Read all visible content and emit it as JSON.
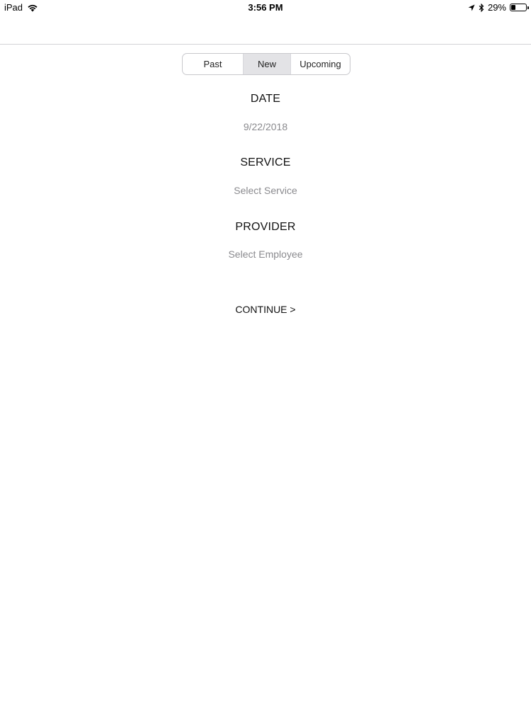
{
  "status_bar": {
    "device": "iPad",
    "time": "3:56 PM",
    "battery_percent": "29%",
    "battery_level": 0.29,
    "icons": [
      "wifi-icon",
      "location-icon",
      "bluetooth-icon",
      "battery-icon"
    ]
  },
  "tabs": {
    "items": [
      {
        "label": "Past",
        "selected": false
      },
      {
        "label": "New",
        "selected": true
      },
      {
        "label": "Upcoming",
        "selected": false
      }
    ],
    "selected_color": "#e3e3e6"
  },
  "form": {
    "date": {
      "label": "DATE",
      "value": "9/22/2018"
    },
    "service": {
      "label": "SERVICE",
      "placeholder": "Select Service"
    },
    "provider": {
      "label": "PROVIDER",
      "placeholder": "Select Employee"
    }
  },
  "actions": {
    "continue_label": "CONTINUE >"
  }
}
